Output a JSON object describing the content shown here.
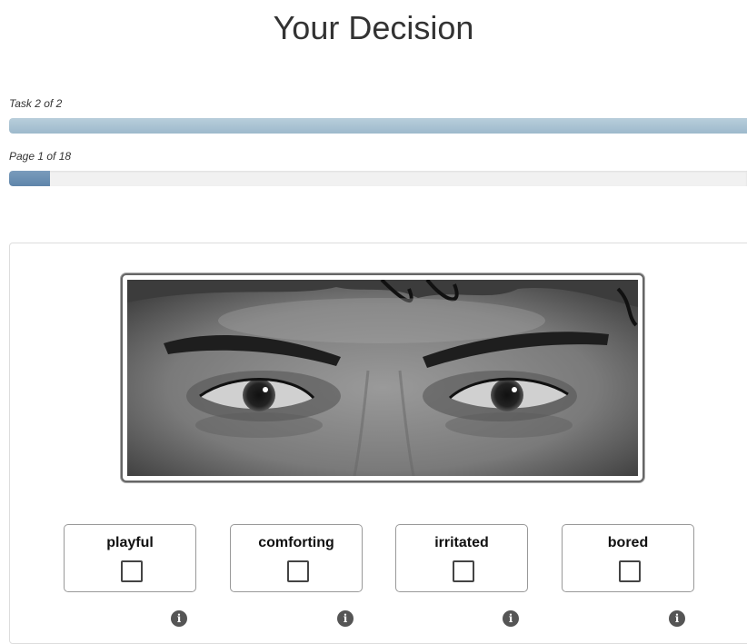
{
  "header": {
    "title": "Your Decision"
  },
  "progress": {
    "task": {
      "label": "Task 2 of 2",
      "fraction": 1.0
    },
    "page": {
      "label": "Page 1 of 18",
      "fraction": 0.056
    }
  },
  "stimulus": {
    "image_description": "face-eyes-region"
  },
  "choices": [
    {
      "label": "playful",
      "checked": false
    },
    {
      "label": "comforting",
      "checked": false
    },
    {
      "label": "irritated",
      "checked": false
    },
    {
      "label": "bored",
      "checked": false
    }
  ],
  "icons": {
    "info": "info-icon",
    "info_glyph": "i"
  },
  "colors": {
    "task_bar": "#a9c4d5",
    "page_bar": "#6b8fb2",
    "title_text": "#333333"
  }
}
